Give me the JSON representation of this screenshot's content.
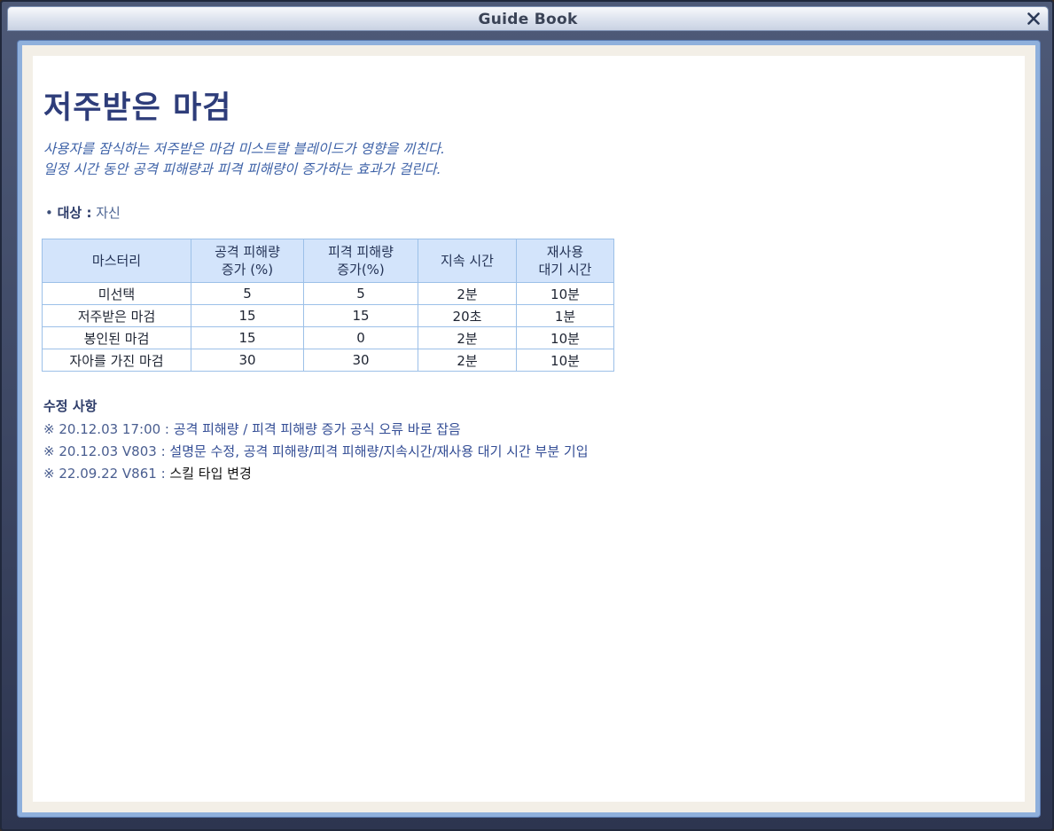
{
  "window": {
    "title": "Guide Book"
  },
  "skill": {
    "name": "저주받은 마검",
    "description": [
      "사용자를 잠식하는 저주받은 마검 미스트랄 블레이드가 영향을 끼친다.",
      "일정 시간 동안 공격 피해량과 피격 피해량이 증가하는 효과가 걸린다."
    ],
    "target_label": "대상 :",
    "target_value": "자신",
    "table": {
      "headers": [
        [
          "마스터리"
        ],
        [
          "공격 피해량",
          "증가 (%)"
        ],
        [
          "피격 피해량",
          "증가(%)"
        ],
        [
          "지속 시간"
        ],
        [
          "재사용",
          "대기 시간"
        ]
      ],
      "rows": [
        [
          "미선택",
          "5",
          "5",
          "2분",
          "10분"
        ],
        [
          "저주받은 마검",
          "15",
          "15",
          "20초",
          "1분"
        ],
        [
          "봉인된 마검",
          "15",
          "0",
          "2분",
          "10분"
        ],
        [
          "자아를 가진 마검",
          "30",
          "30",
          "2분",
          "10분"
        ]
      ]
    }
  },
  "changes": {
    "title": "수정 사항",
    "entries": [
      {
        "mark": "※",
        "date": "20.12.03 17:00 :",
        "text": "공격 피해량 / 피격 피해량 증가 공식 오류 바로 잡음"
      },
      {
        "mark": "※",
        "date": "20.12.03 V803 :",
        "text": "설명문 수정, 공격 피해량/피격 피해량/지속시간/재사용 대기 시간 부분 기입"
      },
      {
        "mark": "※",
        "date": "22.09.22 V861 :",
        "text": "스킬 타입 변경"
      }
    ]
  },
  "colors": {
    "heading": "#2e3d7a",
    "description": "#3f63a8",
    "table_header_bg": "#d3e4fb",
    "table_border": "#9cc0e8"
  }
}
